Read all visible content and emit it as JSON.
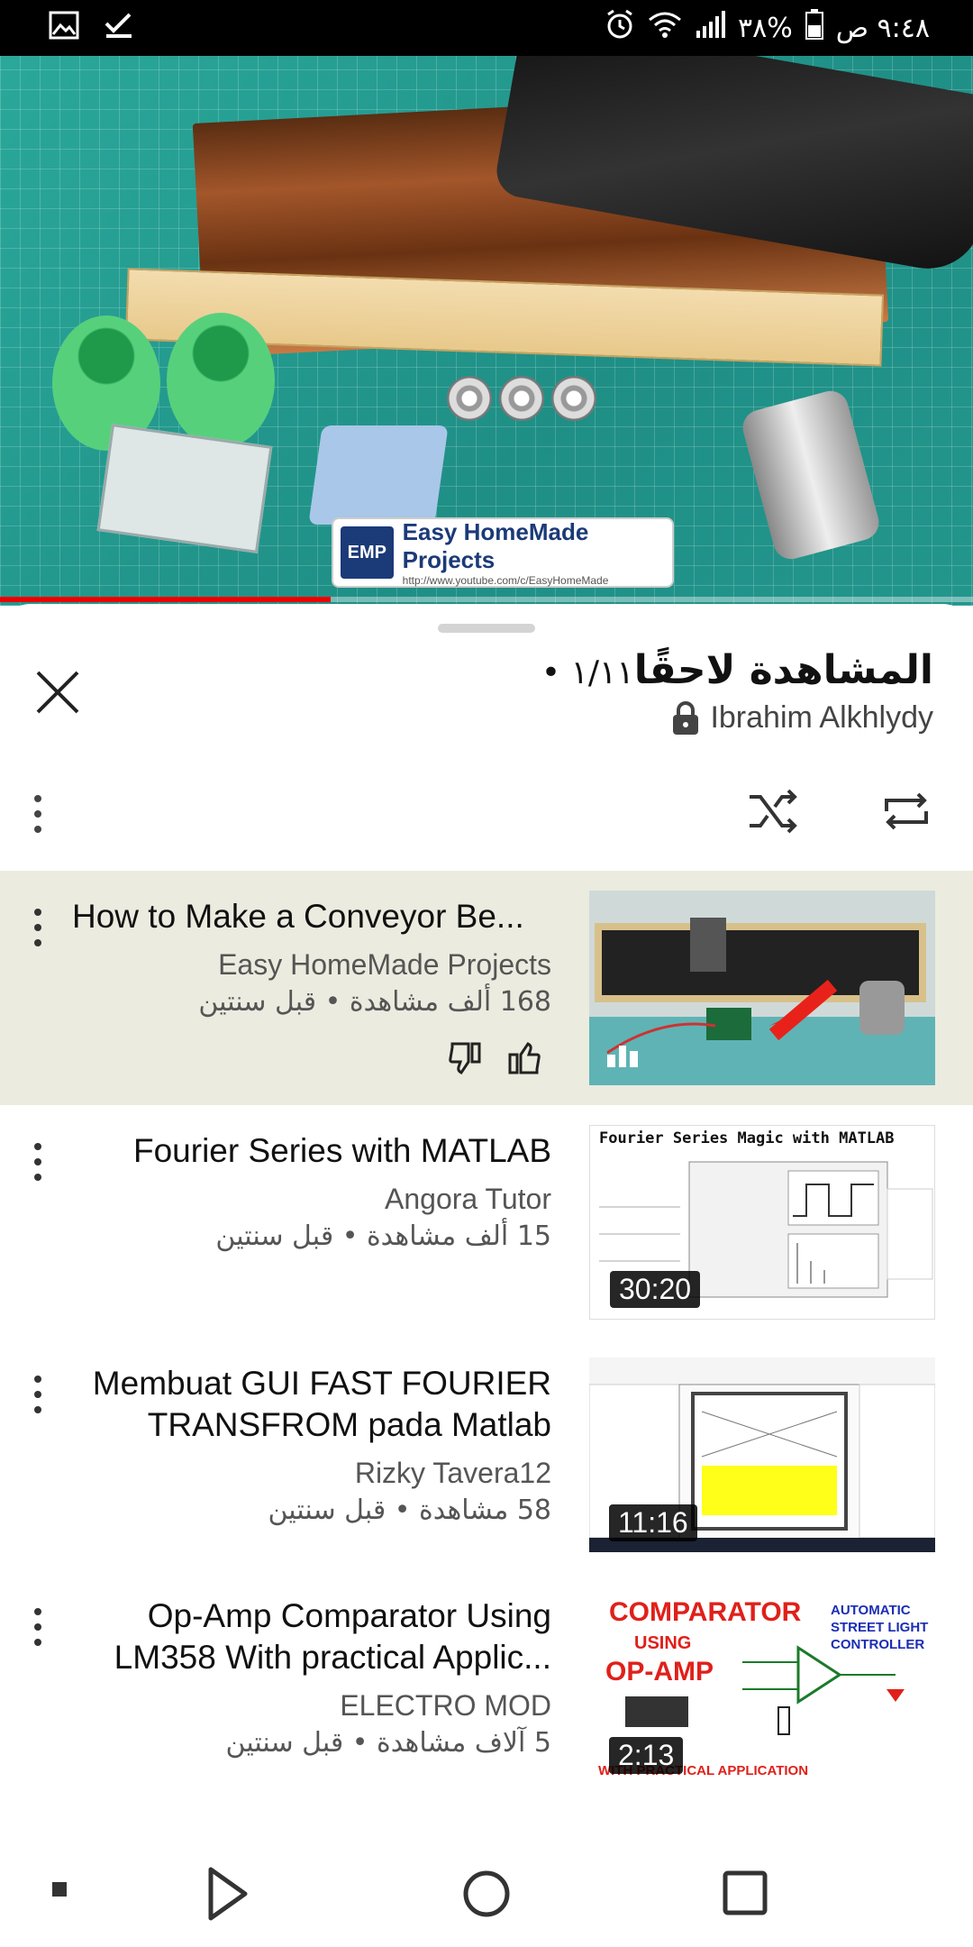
{
  "status_bar": {
    "time": "٩:٤٨ ص",
    "battery": "٣٨%",
    "icons": [
      "gallery-icon",
      "check-icon",
      "alarm-icon",
      "wifi-icon",
      "signal-icon",
      "battery-icon"
    ]
  },
  "video": {
    "logo_text": "Easy HomeMade Projects",
    "logo_badge": "EMP",
    "logo_url": "http://www.youtube.com/c/EasyHomeMade",
    "progress": 0.34
  },
  "playlist": {
    "title": "المشاهدة لاحقًا",
    "position": "١/١١",
    "owner": "Ibrahim Alkhlydy"
  },
  "items": [
    {
      "title": "How to Make a Conveyor Be...",
      "channel": "Easy HomeMade Projects",
      "meta": "168 ألف مشاهدة • قبل سنتين",
      "duration": "",
      "active": true
    },
    {
      "title": "Fourier Series with MATLAB",
      "channel": "Angora Tutor",
      "meta": "15 ألف مشاهدة • قبل سنتين",
      "duration": "30:20",
      "thumb_title": "Fourier Series Magic with MATLAB"
    },
    {
      "title": "Membuat GUI FAST FOURIER TRANSFROM pada Matlab",
      "channel": "Rizky Tavera12",
      "meta": "58 مشاهدة • قبل سنتين",
      "duration": "11:16"
    },
    {
      "title": "Op-Amp Comparator Using LM358 With practical Applic...",
      "channel": "ELECTRO MOD",
      "meta": "5 آلاف مشاهدة • قبل سنتين",
      "duration": "2:13",
      "thumb_lines": [
        "COMPARATOR",
        "USING",
        "OP-AMP",
        "AUTOMATIC",
        "STREET LIGHT",
        "CONTROLLER",
        "WITH PRACTICAL APPLICATION"
      ]
    }
  ],
  "colors": {
    "accent": "#ff0000",
    "active_row": "#ebebdf",
    "text_primary": "#111111",
    "text_secondary": "#555555"
  }
}
